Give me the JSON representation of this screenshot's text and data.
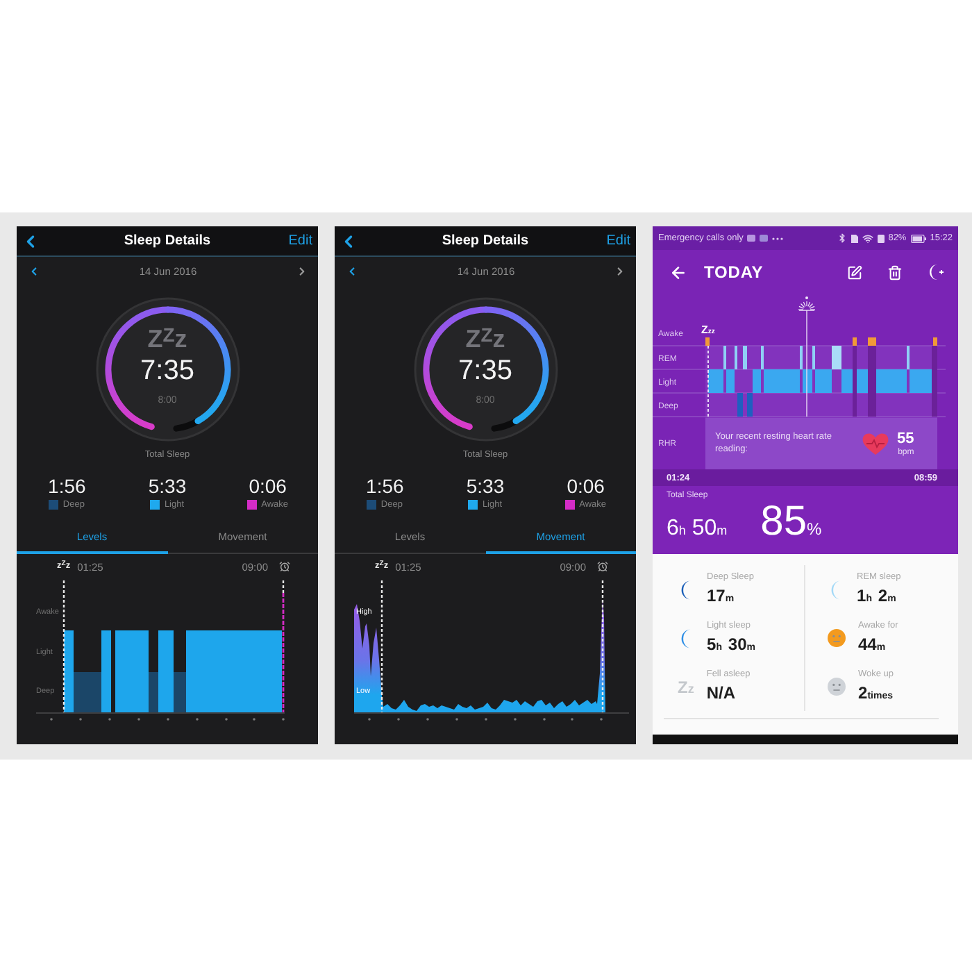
{
  "screens": [
    {
      "kind": "sleep_details",
      "title": "Sleep Details",
      "action": "Edit",
      "date": "14 Jun 2016",
      "dial": {
        "glyph": "Z$^{Z}$z",
        "total": "7:35",
        "goal": "8:00",
        "label": "Total Sleep"
      },
      "stats": [
        {
          "value": "1:56",
          "label": "Deep",
          "color": "#1c4c78"
        },
        {
          "value": "5:33",
          "label": "Light",
          "color": "#1fa9ee"
        },
        {
          "value": "0:06",
          "label": "Awake",
          "color": "#d42cc6"
        }
      ],
      "tabs": [
        {
          "label": "Levels",
          "selected": true
        },
        {
          "label": "Movement",
          "selected": false
        }
      ],
      "chart": {
        "kind": "levels",
        "glyph": "z$^{Z}$z",
        "start": "01:25",
        "end": "09:00",
        "axis_labels": [
          "Awake",
          "Light",
          "Deep"
        ]
      }
    },
    {
      "kind": "sleep_details",
      "title": "Sleep Details",
      "action": "Edit",
      "date": "14 Jun 2016",
      "dial": {
        "glyph": "Z$^{Z}$z",
        "total": "7:35",
        "goal": "8:00",
        "label": "Total Sleep"
      },
      "stats": [
        {
          "value": "1:56",
          "label": "Deep",
          "color": "#1c4c78"
        },
        {
          "value": "5:33",
          "label": "Light",
          "color": "#1fa9ee"
        },
        {
          "value": "0:06",
          "label": "Awake",
          "color": "#d42cc6"
        }
      ],
      "tabs": [
        {
          "label": "Levels",
          "selected": false
        },
        {
          "label": "Movement",
          "selected": true
        }
      ],
      "chart": {
        "kind": "movement",
        "glyph": "z$^{Z}$z",
        "start": "01:25",
        "end": "09:00",
        "axis_labels": [
          "High",
          "Low"
        ]
      }
    },
    {
      "kind": "sleep_today",
      "status_bar": {
        "carrier": "Emergency calls only",
        "battery": "82%",
        "time": "15:22"
      },
      "title": "TODAY",
      "chart": {
        "glyph": "Zzz",
        "rows": [
          "Awake",
          "REM",
          "Light",
          "Deep"
        ],
        "start": "01:24",
        "end": "08:59"
      },
      "rhr": {
        "label": "RHR",
        "text": "Your recent resting heart rate reading:",
        "value": "55",
        "unit": "bpm"
      },
      "total": {
        "label": "Total Sleep",
        "duration": [
          {
            "num": "6",
            "unit": "h"
          },
          {
            "num": "50",
            "unit": "m"
          }
        ],
        "score": [
          {
            "num": "85",
            "unit": "%"
          }
        ]
      },
      "metrics": [
        {
          "kind": "moon",
          "label": "Deep Sleep",
          "value": [
            {
              "num": "17",
              "unit": "m"
            }
          ],
          "color": "#1b5fb8"
        },
        {
          "kind": "moon",
          "label": "REM sleep",
          "value": [
            {
              "num": "1",
              "unit": "h"
            },
            {
              "num": "2",
              "unit": "m"
            }
          ],
          "color": "#a3d9f7"
        },
        {
          "kind": "moon",
          "label": "Light sleep",
          "value": [
            {
              "num": "5",
              "unit": "h"
            },
            {
              "num": "30",
              "unit": "m"
            }
          ],
          "color": "#2f8fe6"
        },
        {
          "kind": "face",
          "label": "Awake for",
          "value": [
            {
              "num": "44",
              "unit": "m"
            }
          ],
          "color": "#f39a1e"
        },
        {
          "kind": "glyph",
          "glyph": "Zz",
          "label": "Fell asleep",
          "value": [
            {
              "num": "N/A"
            }
          ],
          "color": "#c4c8cc"
        },
        {
          "kind": "face",
          "label": "Woke up",
          "value": [
            {
              "num": "2",
              "unit": "times"
            }
          ],
          "color": "#cfd3d8"
        }
      ]
    }
  ]
}
